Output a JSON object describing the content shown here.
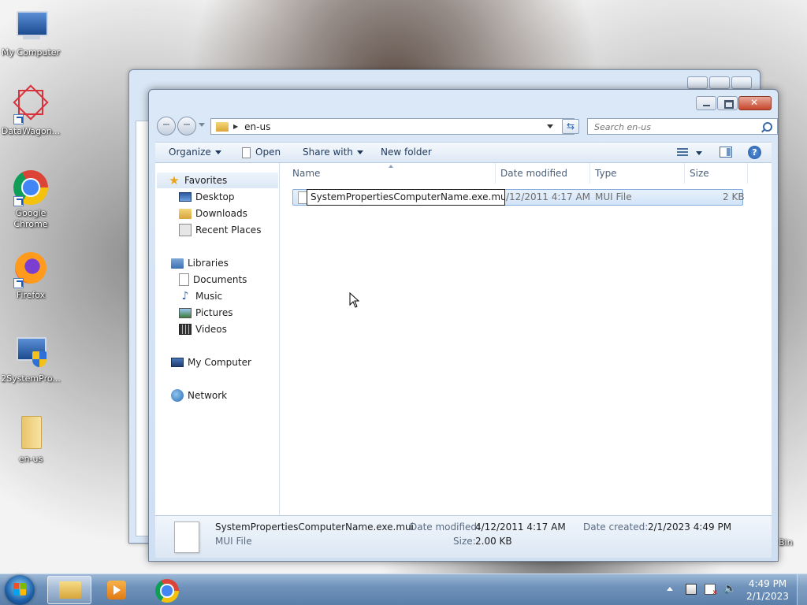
{
  "desktop": {
    "icons": [
      {
        "label": "My Computer",
        "icon": "computer-icon"
      },
      {
        "label": "DataWagon...",
        "icon": "datawagon-icon"
      },
      {
        "label": "Google Chrome",
        "icon": "chrome-icon"
      },
      {
        "label": "Firefox",
        "icon": "firefox-icon"
      },
      {
        "label": "2SystemPro...",
        "icon": "shield-computer-icon"
      },
      {
        "label": "en-us",
        "icon": "folder-icon"
      }
    ],
    "recycle_bin_partial": "Bin"
  },
  "explorer": {
    "address": {
      "path": "en-us"
    },
    "search": {
      "placeholder": "Search en-us"
    },
    "toolbar": {
      "organize": "Organize",
      "open": "Open",
      "share_with": "Share with",
      "new_folder": "New folder"
    },
    "nav": {
      "favorites": "Favorites",
      "desktop": "Desktop",
      "downloads": "Downloads",
      "recent_places": "Recent Places",
      "libraries": "Libraries",
      "documents": "Documents",
      "music": "Music",
      "pictures": "Pictures",
      "videos": "Videos",
      "my_computer": "My Computer",
      "network": "Network"
    },
    "columns": {
      "name": "Name",
      "date_modified": "Date modified",
      "type": "Type",
      "size": "Size"
    },
    "files": [
      {
        "name": "SystemPropertiesComputerName.exe.mui",
        "date_modified": "/12/2011 4:17 AM",
        "type": "MUI File",
        "size": "2 KB"
      }
    ],
    "details": {
      "name": "SystemPropertiesComputerName.exe.mui",
      "type": "MUI File",
      "date_modified_label": "Date modified:",
      "date_modified": "4/12/2011 4:17 AM",
      "size_label": "Size:",
      "size": "2.00 KB",
      "date_created_label": "Date created:",
      "date_created": "2/1/2023 4:49 PM"
    }
  },
  "taskbar": {
    "time": "4:49 PM",
    "date": "2/1/2023"
  }
}
